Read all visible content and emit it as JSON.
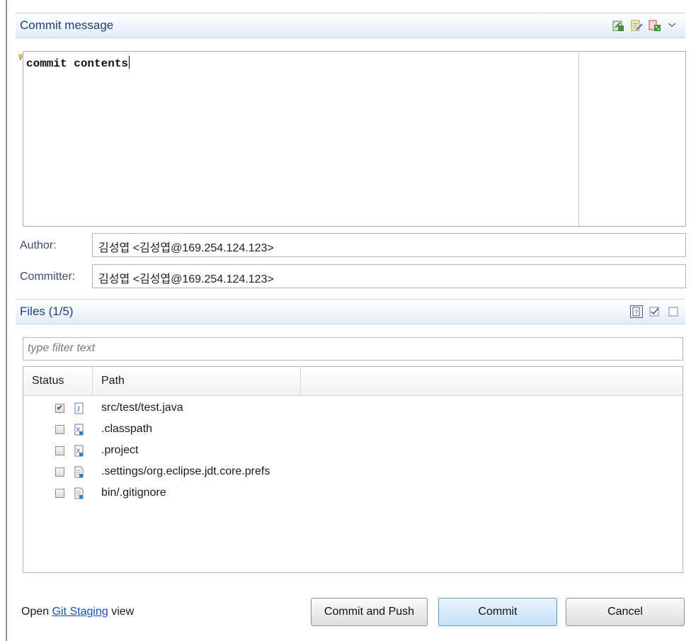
{
  "commit_section": {
    "title": "Commit message",
    "message": "commit contents",
    "toolbar_icons": [
      "amend-icon",
      "signed-off-icon",
      "change-id-icon",
      "view-menu-chevron-icon"
    ]
  },
  "author": {
    "label": "Author:",
    "value": "김성엽 <김성엽@169.254.124.123>"
  },
  "committer": {
    "label": "Committer:",
    "value": "김성엽 <김성엽@169.254.124.123>"
  },
  "files_section": {
    "title": "Files (1/5)",
    "toolbar_icons": [
      "show-untracked-icon",
      "select-all-icon",
      "deselect-all-icon"
    ],
    "filter_placeholder": "type filter text",
    "columns": [
      "Status",
      "Path"
    ],
    "rows": [
      {
        "checked": true,
        "icon": "java-file-icon",
        "path": "src/test/test.java"
      },
      {
        "checked": false,
        "icon": "xml-file-icon",
        "path": ".classpath"
      },
      {
        "checked": false,
        "icon": "xml-file-icon",
        "path": ".project"
      },
      {
        "checked": false,
        "icon": "text-file-icon",
        "path": ".settings/org.eclipse.jdt.core.prefs"
      },
      {
        "checked": false,
        "icon": "text-file-icon",
        "path": "bin/.gitignore"
      }
    ]
  },
  "footer": {
    "open_prefix": "Open",
    "link": "Git Staging",
    "open_suffix": "view",
    "buttons": {
      "commit_and_push": "Commit and Push",
      "commit": "Commit",
      "cancel": "Cancel"
    }
  },
  "colors": {
    "header_text": "#1c3f78",
    "link": "#1b4fb7",
    "primary_button": "#c7e1f8"
  }
}
